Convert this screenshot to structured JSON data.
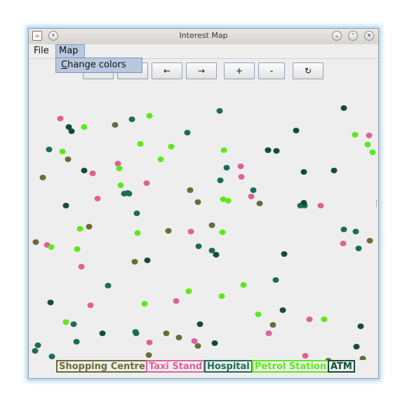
{
  "window": {
    "title": "Interest Map",
    "app_icon": "java-cup-icon",
    "controls": [
      "minimize-icon",
      "maximize-icon",
      "close-icon"
    ],
    "pin_icon": "pin-icon"
  },
  "menubar": {
    "file_label": "File",
    "map_label": "Map"
  },
  "map_menu": {
    "items": [
      {
        "label": "Change colors",
        "mnemonic": "C"
      }
    ]
  },
  "toolbar": {
    "left_label": "←",
    "right_label": "→",
    "zoom_in_label": "+",
    "zoom_out_label": "-",
    "refresh_label": "↻"
  },
  "categories": {
    "shopping": {
      "name": "Shopping Centre",
      "color": "#6b6b35"
    },
    "taxi": {
      "name": "Taxi Stand",
      "color": "#e0609a"
    },
    "hospital": {
      "name": "Hospital",
      "color": "#1d6b58"
    },
    "petrol": {
      "name": "Petrol Station",
      "color": "#5ee81b"
    },
    "atm": {
      "name": "ATM",
      "color": "#134d36"
    }
  }
}
